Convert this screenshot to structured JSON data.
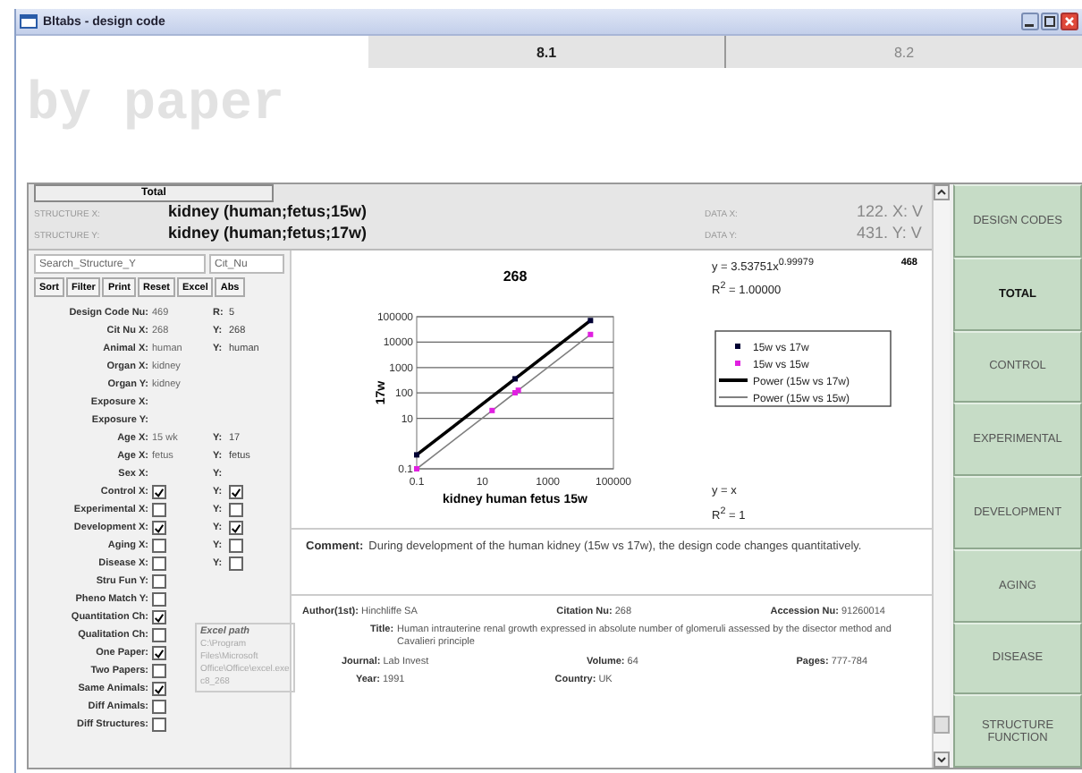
{
  "window": {
    "title": "Bltabs - design code"
  },
  "tabs": [
    {
      "label": "8.1",
      "selected": true
    },
    {
      "label": "8.2",
      "selected": false
    }
  ],
  "heading": "by paper",
  "panel_tab": "Total",
  "structures": [
    {
      "label": "STRUCTURE X:",
      "value": "kidney (human;fetus;15w)",
      "data_label": "DATA X:",
      "data_value": "122. X: V"
    },
    {
      "label": "STRUCTURE Y:",
      "value": "kidney (human;fetus;17w)",
      "data_label": "DATA Y:",
      "data_value": "431. Y: V"
    }
  ],
  "search": [
    {
      "value": "Search_Structure_Y"
    },
    {
      "value": "Cit_Nu"
    }
  ],
  "buttons": [
    "Sort",
    "Filter",
    "Print",
    "Reset",
    "Excel",
    "Abs"
  ],
  "fields": [
    {
      "kind": "text",
      "label": "Design Code Nu:",
      "value": "469",
      "label_2": "R:",
      "value_2": "5"
    },
    {
      "kind": "text",
      "label": "Cit Nu X:",
      "value": "268",
      "label_2": "Y:",
      "value_2": "268"
    },
    {
      "kind": "text",
      "label": "Animal X:",
      "value": "human",
      "label_2": "Y:",
      "value_2": "human"
    },
    {
      "kind": "text",
      "label": "Organ X:",
      "value": "kidney"
    },
    {
      "kind": "text",
      "label": "Organ Y:",
      "value": "kidney"
    },
    {
      "kind": "text",
      "label": "Exposure X:"
    },
    {
      "kind": "text",
      "label": "Exposure Y:"
    },
    {
      "kind": "text",
      "label": "Age X:",
      "value": "15 wk",
      "label_2": "Y:",
      "value_2": "17"
    },
    {
      "kind": "text",
      "label": "Age X:",
      "value": "fetus",
      "label_2": "Y:",
      "value_2": "fetus"
    },
    {
      "kind": "text",
      "label": "Sex X:",
      "label_2": "Y:"
    },
    {
      "kind": "check",
      "label": "Control X:",
      "checked": true,
      "label_2": "Y:",
      "checked_2": true
    },
    {
      "kind": "check",
      "label": "Experimental X:",
      "checked": false,
      "label_2": "Y:",
      "checked_2": false
    },
    {
      "kind": "check",
      "label": "Development X:",
      "checked": true,
      "label_2": "Y:",
      "checked_2": true
    },
    {
      "kind": "check",
      "label": "Aging X:",
      "checked": false,
      "label_2": "Y:",
      "checked_2": false
    },
    {
      "kind": "check",
      "label": "Disease X:",
      "checked": false,
      "label_2": "Y:",
      "checked_2": false
    },
    {
      "kind": "check",
      "label": "Stru Fun Y:",
      "checked": false
    },
    {
      "kind": "check",
      "label": "Pheno Match Y:",
      "checked": false
    }
  ],
  "options": [
    {
      "label": "Quantitation Ch:",
      "checked": true
    },
    {
      "label": "Qualitation Ch:",
      "checked": false
    },
    {
      "label": "One Paper:",
      "checked": true
    },
    {
      "label": "Two Papers:",
      "checked": false
    },
    {
      "label": "Same Animals:",
      "checked": true
    },
    {
      "label": "Diff Animals:",
      "checked": false
    },
    {
      "label": "Diff Structures:",
      "checked": false
    }
  ],
  "excel_path": {
    "title": "Excel path",
    "value": "C:\\Program Files\\Microsoft Office\\Office\\excel.exe c8_268"
  },
  "counter": "468",
  "chart": {
    "title": "268",
    "xlabel": "kidney human fetus 15w",
    "ylabel": "17w",
    "legend": [
      {
        "name": "15w vs 17w",
        "color": "#000033",
        "kind": "marker"
      },
      {
        "name": "15w vs 15w",
        "color": "#e020e0",
        "kind": "marker"
      },
      {
        "name": "Power (15w vs 17w)",
        "color": "#000000",
        "kind": "line"
      },
      {
        "name": "Power (15w vs 15w)",
        "color": "#808080",
        "kind": "line"
      }
    ],
    "x_tick_labels": [
      "0.1",
      "10",
      "1000",
      "100000"
    ],
    "y_tick_labels": [
      "100000",
      "10000",
      "1000",
      "100",
      "10",
      "0.1"
    ],
    "annotations": [
      "y = 3.53751x$^{0.99979}$",
      "R$^{2}$ = 1.00000",
      "y = x",
      "R$^{2}$ = 1"
    ]
  },
  "comment": {
    "label": "Comment:",
    "text": "During development of the human kidney (15w vs 17w), the design code changes quantitatively."
  },
  "reference": [
    {
      "label": "Author(1st):",
      "value": "Hinchliffe SA"
    },
    {
      "label": "Citation Nu:",
      "value": "268"
    },
    {
      "label": "Accession Nu:",
      "value": "91260014"
    }
  ],
  "title": {
    "label": "Title:",
    "value": "Human intrauterine renal growth expressed in absolute number of glomeruli assessed by the disector method and Cavalieri principle"
  },
  "journal": [
    {
      "label": "Journal:",
      "value": "Lab Invest"
    },
    {
      "label": "Volume:",
      "value": "64"
    },
    {
      "label": "Pages:",
      "value": "777-784"
    }
  ],
  "year": [
    {
      "label": "Year:",
      "value": "1991"
    },
    {
      "label": "Country:",
      "value": "UK"
    }
  ],
  "sidebar": [
    {
      "label": "DESIGN CODES",
      "selected": false
    },
    {
      "label": "TOTAL",
      "selected": true
    },
    {
      "label": "CONTROL",
      "selected": false
    },
    {
      "label": "EXPERIMENTAL",
      "selected": false
    },
    {
      "label": "DEVELOPMENT",
      "selected": false
    },
    {
      "label": "AGING",
      "selected": false
    },
    {
      "label": "DISEASE",
      "selected": false
    },
    {
      "label": "STRUCTURE FUNCTION",
      "selected": false
    }
  ]
}
